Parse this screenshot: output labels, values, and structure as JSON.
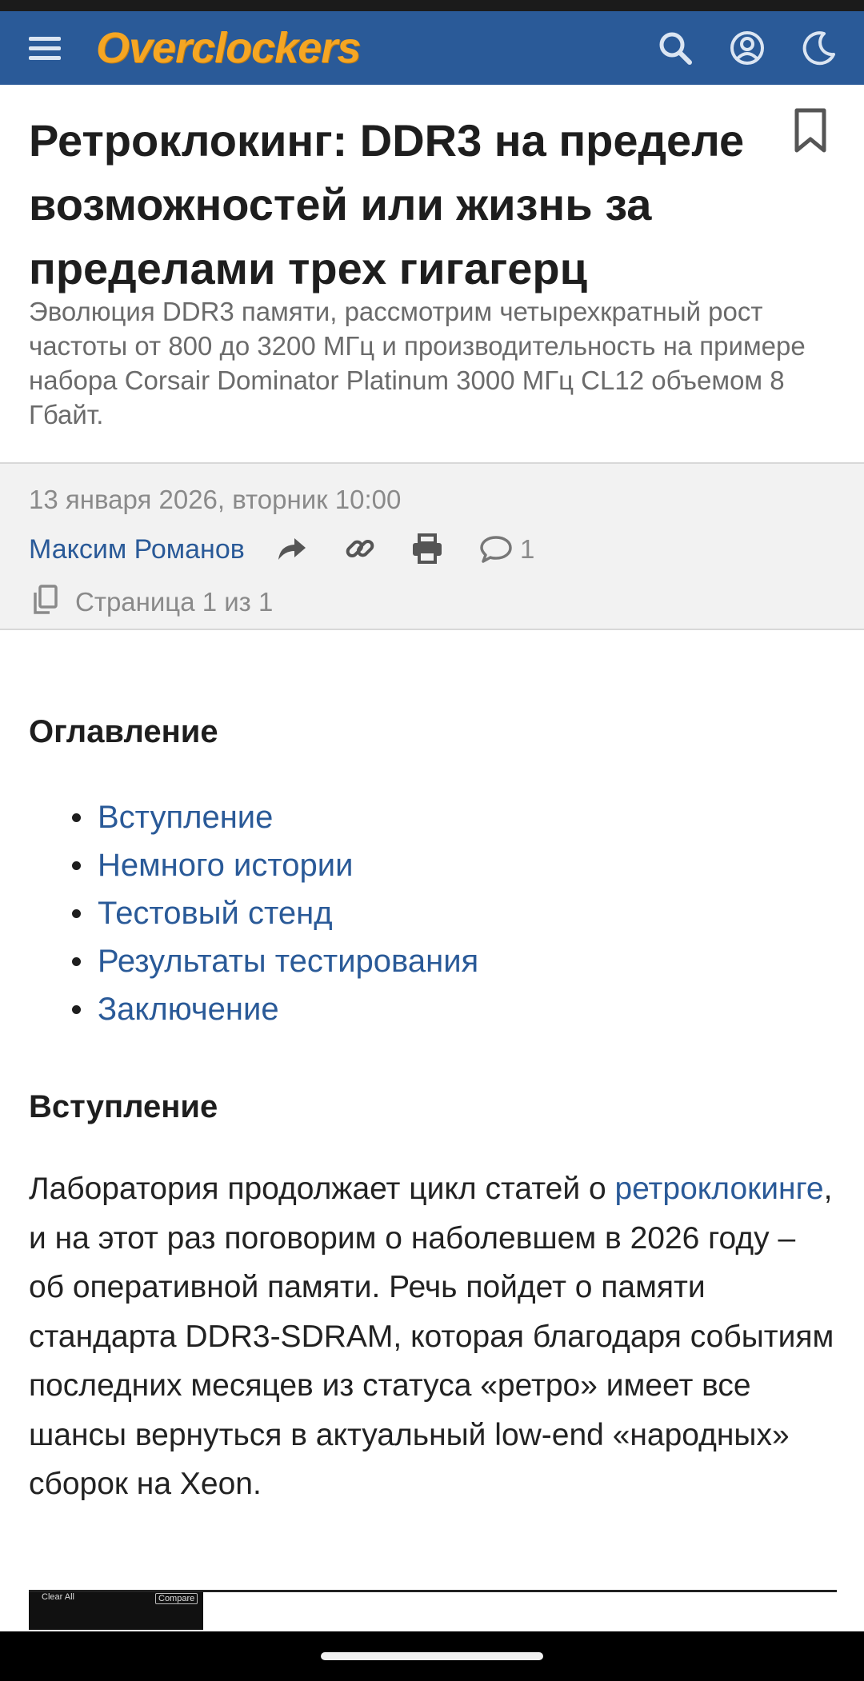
{
  "site": {
    "logo_text": "Overclockers",
    "colors": {
      "brand_bar": "#2a5a98",
      "logo": "#f5a623",
      "link": "#2a5a98"
    },
    "icons": [
      "menu-icon",
      "search-icon",
      "account-icon",
      "dark-mode-moon-icon"
    ]
  },
  "article": {
    "title": "Ретроклокинг: DDR3 на пределе возможностей или жизнь за пределами трех гигагерц",
    "subtitle": "Эволюция DDR3 памяти, рассмотрим четырехкратный рост частоты от 800 до 3200 МГц и производительность на примере набора Corsair Dominator Platinum 3000 МГц CL12 объемом 8 Гбайт.",
    "date": "13 января 2026, вторник 10:00",
    "author": "Максим Романов",
    "comments_count": "1",
    "pages": "Страница 1 из 1",
    "meta_icons": [
      "share-icon",
      "link-icon",
      "print-icon",
      "comment-icon",
      "pages-icon",
      "bookmark-icon"
    ]
  },
  "toc": {
    "heading": "Оглавление",
    "items": [
      {
        "label": "Вступление"
      },
      {
        "label": "Немного истории"
      },
      {
        "label": "Тестовый стенд"
      },
      {
        "label": "Результаты тестирования"
      },
      {
        "label": "Заключение"
      }
    ]
  },
  "intro": {
    "heading": "Вступление",
    "text_before_link": "Лаборатория продолжает цикл статей о ",
    "link_text": "ретроклокинге",
    "text_after_link": ", и на этот раз поговорим о наболевшем в 2026 году – об оперативной памяти. Речь пойдет о памяти стандарта DDR3-SDRAM, которая благодаря событиям последних месяцев из статуса «ретро» имеет все шансы вернуться в актуальный low-end «народных» сборок на Xeon."
  },
  "image_preview": {
    "label_left": "Clear All",
    "label_right": "Compare"
  }
}
